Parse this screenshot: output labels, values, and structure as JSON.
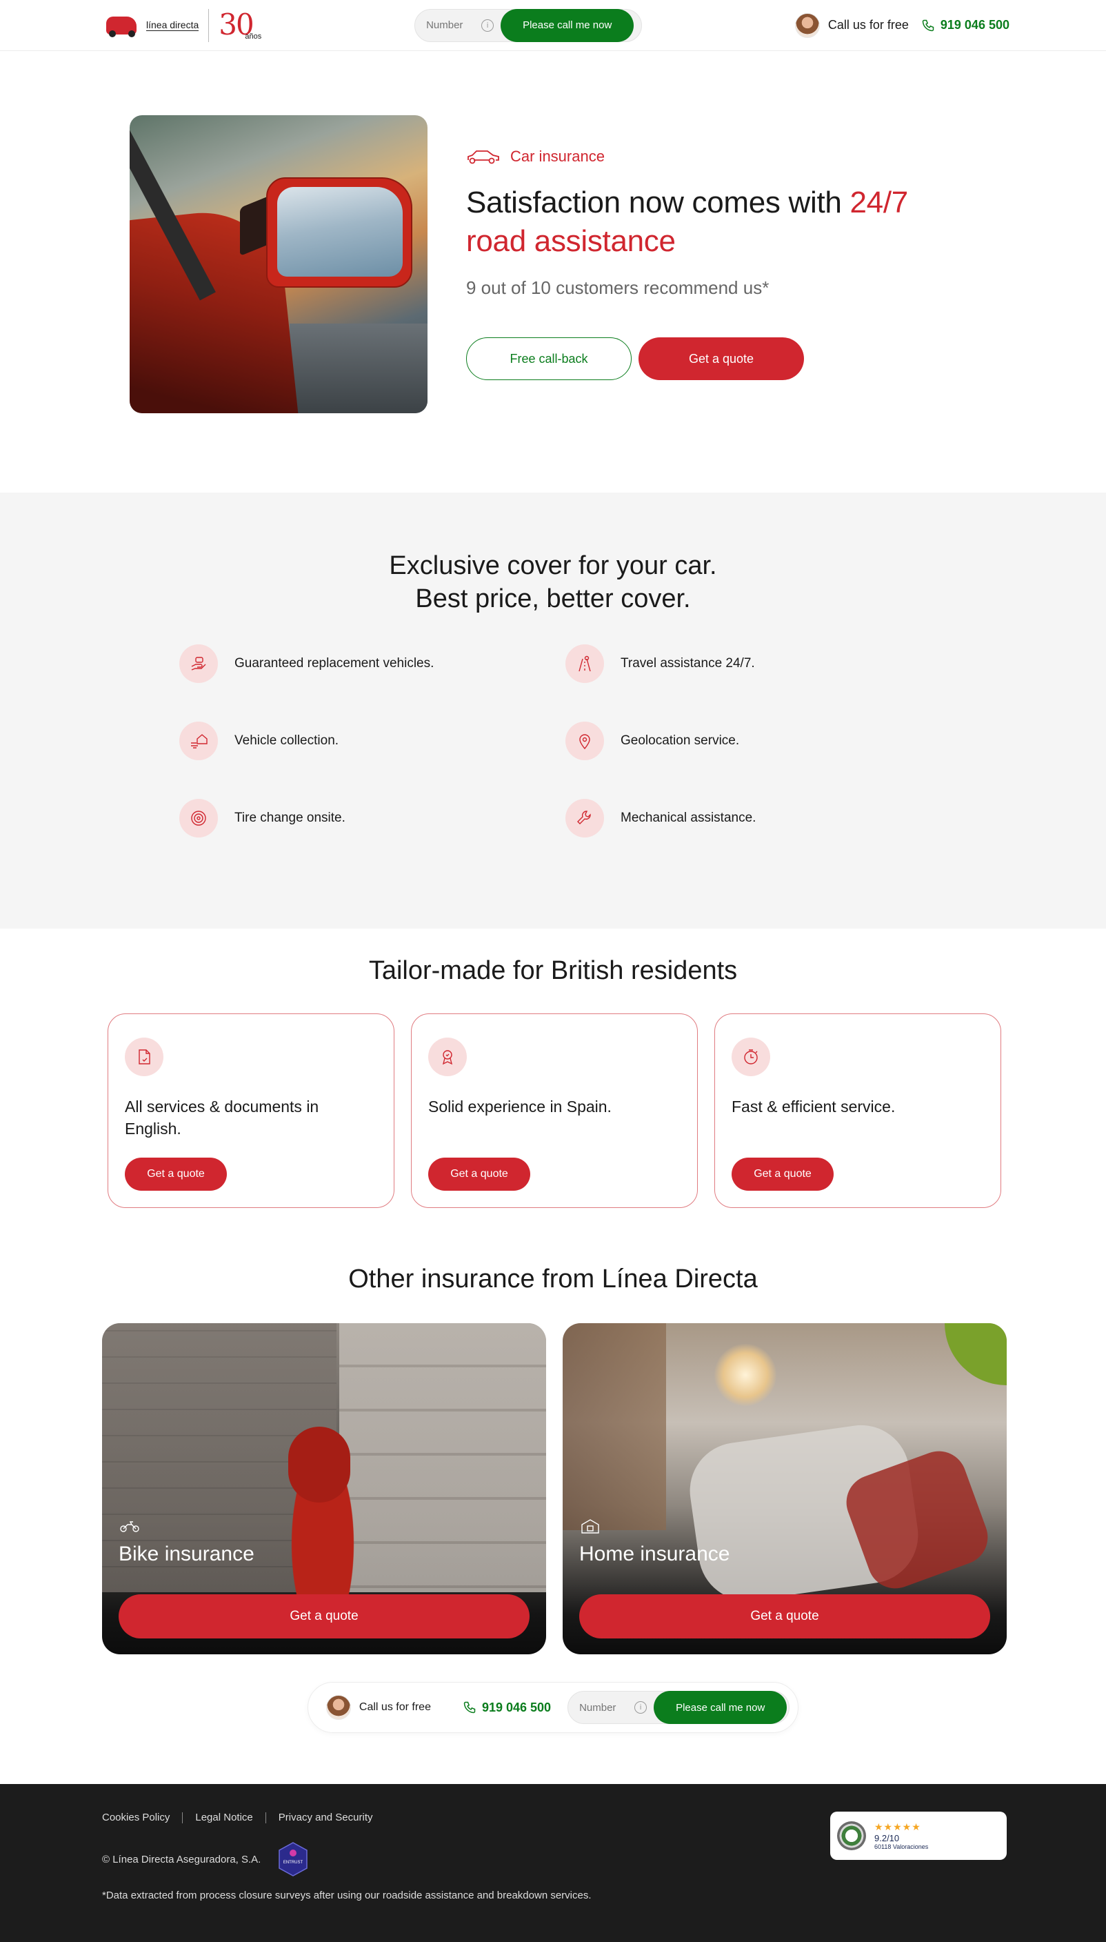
{
  "header": {
    "logo_text": "línea directa",
    "logo_30": "30",
    "logo_anos": "años",
    "number_placeholder": "Number",
    "callback_btn": "Please call me now",
    "call_us": "Call us for free",
    "phone": "919 046 500"
  },
  "hero": {
    "tag": "Car insurance",
    "title_main": "Satisfaction now comes with ",
    "title_accent": "24/7 road assistance",
    "subtitle": "9 out of 10 customers recommend us*",
    "btn_callback": "Free call-back",
    "btn_quote": "Get a quote"
  },
  "features": {
    "title_line1": "Exclusive cover for your car.",
    "title_line2": "Best price, better cover.",
    "items": [
      {
        "label": "Guaranteed replacement vehicles.",
        "icon": "hand-key-icon"
      },
      {
        "label": "Travel assistance 24/7.",
        "icon": "road-pin-icon"
      },
      {
        "label": "Vehicle collection.",
        "icon": "tow-house-icon"
      },
      {
        "label": "Geolocation service.",
        "icon": "location-pin-icon"
      },
      {
        "label": "Tire change onsite.",
        "icon": "tire-icon"
      },
      {
        "label": "Mechanical assistance.",
        "icon": "wrench-icon"
      }
    ]
  },
  "tailor": {
    "title": "Tailor-made for British residents",
    "cards": [
      {
        "text": "All services & documents in English.",
        "btn": "Get a quote",
        "icon": "document-check-icon"
      },
      {
        "text": "Solid experience in Spain.",
        "btn": "Get a quote",
        "icon": "award-icon"
      },
      {
        "text": "Fast & efficient service.",
        "btn": "Get a quote",
        "icon": "stopwatch-icon"
      }
    ]
  },
  "other": {
    "title": "Other insurance from Línea Directa",
    "cards": [
      {
        "title": "Bike insurance",
        "btn": "Get a quote",
        "icon": "motorbike-icon"
      },
      {
        "title": "Home insurance",
        "btn": "Get a quote",
        "icon": "home-icon"
      }
    ]
  },
  "bottom_bar": {
    "call_us": "Call us for free",
    "phone": "919 046 500",
    "number_placeholder": "Number",
    "callback_btn": "Please call me now"
  },
  "footer": {
    "links": [
      "Cookies Policy",
      "Legal Notice",
      "Privacy and Security"
    ],
    "copyright": "© Línea Directa Aseguradora, S.A.",
    "note": "*Data extracted from process closure surveys after using our roadside assistance and breakdown services.",
    "rating": {
      "stars": "★★★★★",
      "score": "9.2/10",
      "count": "60118 Valoraciones"
    },
    "entrust_label": "ENTRUST"
  },
  "colors": {
    "brand_red": "#d0262f",
    "brand_green": "#0b7d1d",
    "icon_bg": "#f8dddd",
    "footer_bg": "#1c1c1c"
  }
}
